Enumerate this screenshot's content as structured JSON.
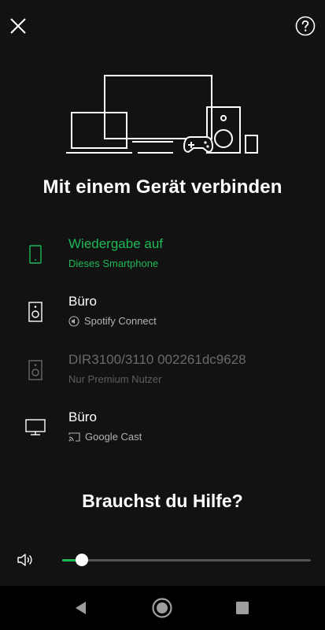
{
  "header": {
    "close_icon": "close-icon",
    "help_icon": "question-circle-icon"
  },
  "title": "Mit einem Gerät verbinden",
  "devices": [
    {
      "name": "Wiedergabe auf",
      "subtitle": "Dieses Smartphone",
      "icon": "smartphone-icon",
      "state": "active"
    },
    {
      "name": "Büro",
      "subtitle": "Spotify Connect",
      "icon": "speaker-icon",
      "sub_icon": "spotify-connect-icon",
      "state": "normal"
    },
    {
      "name": "DIR3100/3110 002261dc9628",
      "subtitle": "Nur Premium Nutzer",
      "icon": "speaker-icon",
      "state": "disabled"
    },
    {
      "name": "Büro",
      "subtitle": "Google Cast",
      "icon": "tv-icon",
      "sub_icon": "cast-icon",
      "state": "normal"
    }
  ],
  "help_title": "Brauchst du Hilfe?",
  "volume": {
    "level": 0.08
  },
  "colors": {
    "accent": "#1db954",
    "background": "#121212",
    "disabled": "#6a6a6a"
  }
}
